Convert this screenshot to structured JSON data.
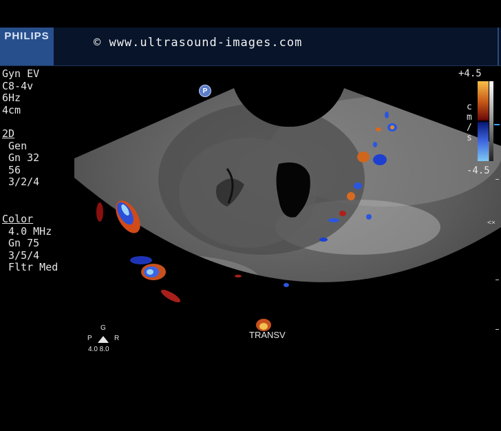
{
  "header": {
    "brand": "PHILIPS",
    "copyright": "© www.ultrasound-images.com"
  },
  "probe_info": {
    "lines": [
      "Gyn EV",
      "C8-4v",
      "6Hz",
      "4cm"
    ]
  },
  "mode_2d": {
    "title": "2D",
    "lines": [
      " Gen",
      " Gn 32",
      " 56",
      " 3/2/4"
    ]
  },
  "mode_color": {
    "title": "Color",
    "lines": [
      " 4.0 MHz",
      " Gn 75",
      " 3/5/4",
      " Fltr Med"
    ]
  },
  "probe_marker": "P",
  "color_scale": {
    "max": "+4.5",
    "min": "-4.5",
    "unit": "c\nm\n/\ns",
    "colors": {
      "positive_high": "#f7c04a",
      "positive_low": "#6e0a0a",
      "negative_low": "#0a1a7a",
      "negative_high": "#7ec8f2"
    }
  },
  "orientation": {
    "top": "G",
    "left": "P",
    "right": "R",
    "scale": "4.0 8.0"
  },
  "plane_label": "TRANSV",
  "depth_marker_icon": "focus-marker-icon"
}
